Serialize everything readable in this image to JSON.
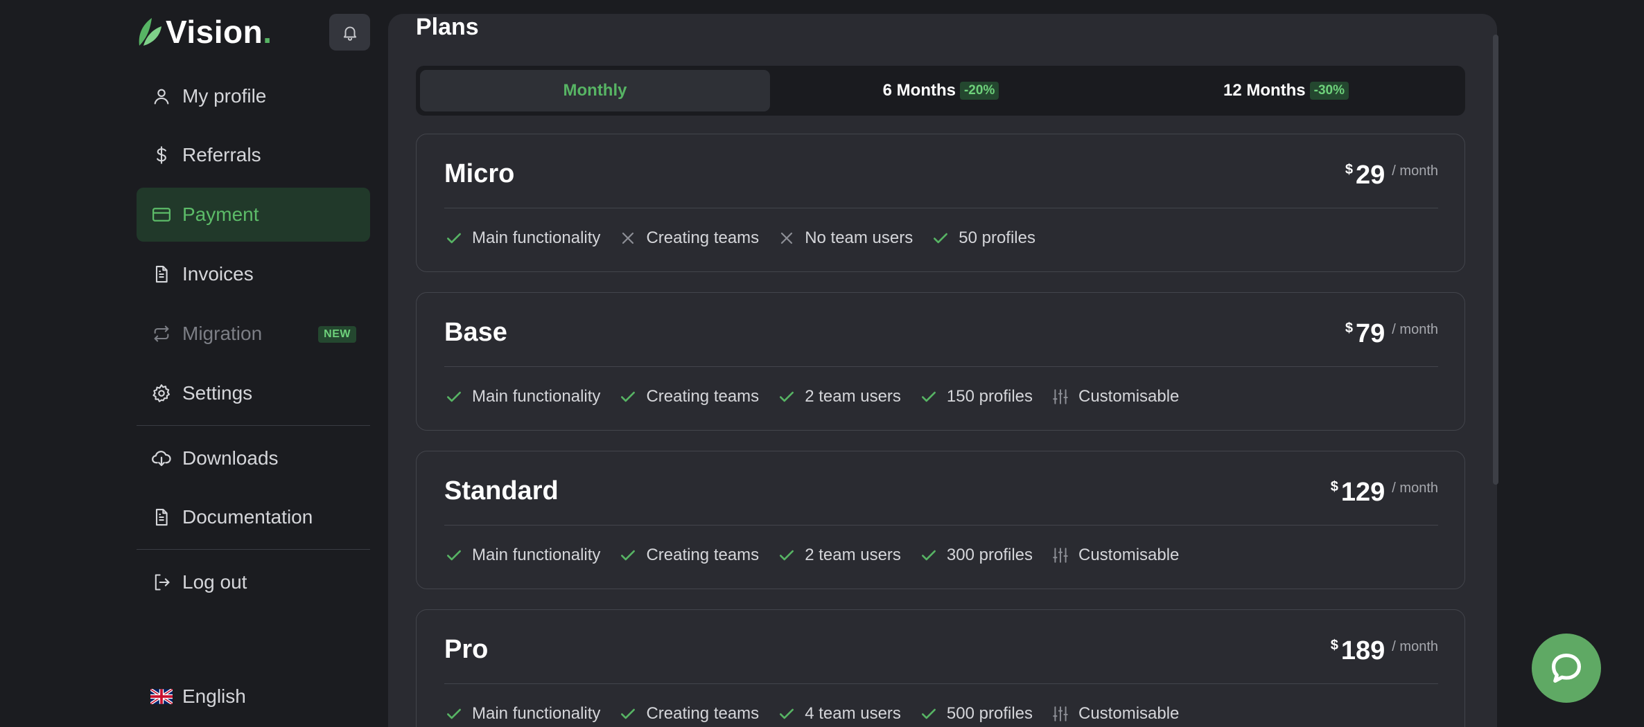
{
  "brand": {
    "name": "Vision",
    "dot": ".",
    "accent": "#57b464"
  },
  "sidebar": {
    "items": [
      {
        "label": "My profile",
        "icon": "user-icon"
      },
      {
        "label": "Referrals",
        "icon": "dollar-icon"
      },
      {
        "label": "Payment",
        "icon": "credit-card-icon",
        "active": true
      },
      {
        "label": "Invoices",
        "icon": "document-icon"
      },
      {
        "label": "Migration",
        "icon": "swap-icon",
        "badge": "NEW",
        "disabled": true
      },
      {
        "label": "Settings",
        "icon": "gear-icon"
      },
      {
        "label": "Downloads",
        "icon": "cloud-download-icon"
      },
      {
        "label": "Documentation",
        "icon": "document-icon"
      },
      {
        "label": "Log out",
        "icon": "logout-icon"
      }
    ],
    "language": {
      "label": "English",
      "icon": "uk-flag-icon"
    }
  },
  "main": {
    "title": "Plans",
    "periods": [
      {
        "label": "Monthly",
        "discount": "",
        "active": true
      },
      {
        "label": "6 Months",
        "discount": "-20%"
      },
      {
        "label": "12 Months",
        "discount": "-30%"
      }
    ],
    "plans": [
      {
        "name": "Micro",
        "currency": "$",
        "price": "29",
        "per": "/ month",
        "features": [
          {
            "label": "Main functionality",
            "type": "check"
          },
          {
            "label": "Creating teams",
            "type": "cross"
          },
          {
            "label": "No team users",
            "type": "cross"
          },
          {
            "label": "50 profiles",
            "type": "check"
          }
        ]
      },
      {
        "name": "Base",
        "currency": "$",
        "price": "79",
        "per": "/ month",
        "features": [
          {
            "label": "Main functionality",
            "type": "check"
          },
          {
            "label": "Creating teams",
            "type": "check"
          },
          {
            "label": "2 team users",
            "type": "check"
          },
          {
            "label": "150 profiles",
            "type": "check"
          },
          {
            "label": "Customisable",
            "type": "sliders"
          }
        ]
      },
      {
        "name": "Standard",
        "currency": "$",
        "price": "129",
        "per": "/ month",
        "features": [
          {
            "label": "Main functionality",
            "type": "check"
          },
          {
            "label": "Creating teams",
            "type": "check"
          },
          {
            "label": "2 team users",
            "type": "check"
          },
          {
            "label": "300 profiles",
            "type": "check"
          },
          {
            "label": "Customisable",
            "type": "sliders"
          }
        ]
      },
      {
        "name": "Pro",
        "currency": "$",
        "price": "189",
        "per": "/ month",
        "features": [
          {
            "label": "Main functionality",
            "type": "check"
          },
          {
            "label": "Creating teams",
            "type": "check"
          },
          {
            "label": "4 team users",
            "type": "check"
          },
          {
            "label": "500 profiles",
            "type": "check"
          },
          {
            "label": "Customisable",
            "type": "sliders"
          }
        ]
      }
    ]
  }
}
